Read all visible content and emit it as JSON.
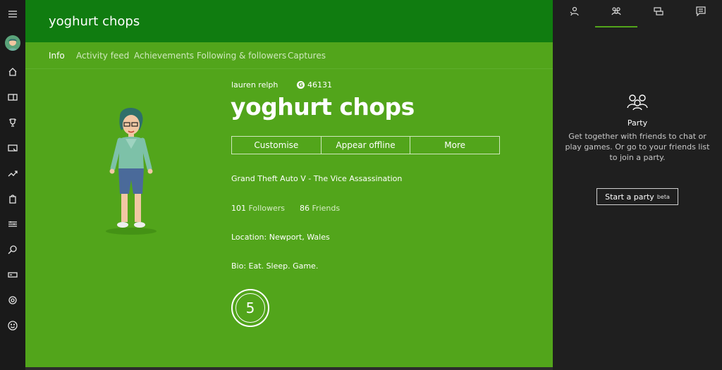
{
  "header": {
    "title": "yoghurt chops"
  },
  "tabs": [
    {
      "label": "Info"
    },
    {
      "label": "Activity feed"
    },
    {
      "label": "Achievements"
    },
    {
      "label": "Following & followers"
    },
    {
      "label": "Captures"
    }
  ],
  "profile": {
    "real_name": "lauren relph",
    "gamerscore_glyph": "G",
    "gamerscore": "46131",
    "gamertag": "yoghurt chops",
    "presence": "Grand Theft Auto V - The Vice Assassination",
    "followers_count": "101",
    "followers_label": "Followers",
    "friends_count": "86",
    "friends_label": "Friends",
    "location": "Location: Newport, Wales",
    "bio": "Bio: Eat. Sleep. Game.",
    "reputation": "5"
  },
  "actions": {
    "customise": "Customise",
    "appear_offline": "Appear offline",
    "more": "More"
  },
  "party": {
    "title": "Party",
    "description": "Get together with friends to chat or play games. Or go to your friends list to join a party.",
    "start_label": "Start a party",
    "beta_label": "beta"
  },
  "icons": {
    "rail": [
      "hamburger-icon",
      "avatar",
      "home-icon",
      "my-games-icon",
      "achievements-trophy-icon",
      "game-dvr-icon",
      "trending-icon",
      "store-icon",
      "connect-icon",
      "search-icon",
      "devices-icon",
      "settings-gear-icon",
      "feedback-smiley-icon"
    ],
    "right_tabs": [
      "friends-icon",
      "party-icon",
      "messages-icon",
      "notifications-icon"
    ]
  },
  "colors": {
    "header_green": "#107c10",
    "body_green": "#52a51b",
    "rail_dark": "#1a1a1a",
    "panel_dark": "#1f1f1f",
    "accent": "#52a51b"
  }
}
